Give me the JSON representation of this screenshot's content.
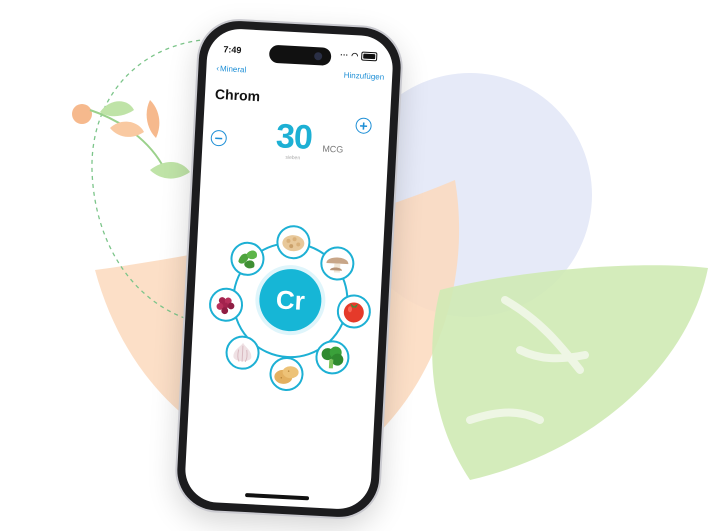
{
  "status": {
    "time": "7:49"
  },
  "nav": {
    "back_label": "Mineral",
    "action_label": "Hinzufügen"
  },
  "title": "Chrom",
  "dose": {
    "value": "30",
    "sub_label": "sieben",
    "unit": "MCG"
  },
  "element": {
    "symbol": "Cr"
  },
  "foods": [
    {
      "name": "oats-icon"
    },
    {
      "name": "mushroom-icon"
    },
    {
      "name": "tomato-icon"
    },
    {
      "name": "broccoli-icon"
    },
    {
      "name": "potato-icon"
    },
    {
      "name": "garlic-icon"
    },
    {
      "name": "grapes-icon"
    },
    {
      "name": "basil-icon"
    }
  ],
  "colors": {
    "accent": "#1db0d4",
    "link": "#1e8fd6",
    "peach": "#f9c9a1",
    "green": "#cfeab4",
    "blue_blob": "#e6eaf8"
  }
}
